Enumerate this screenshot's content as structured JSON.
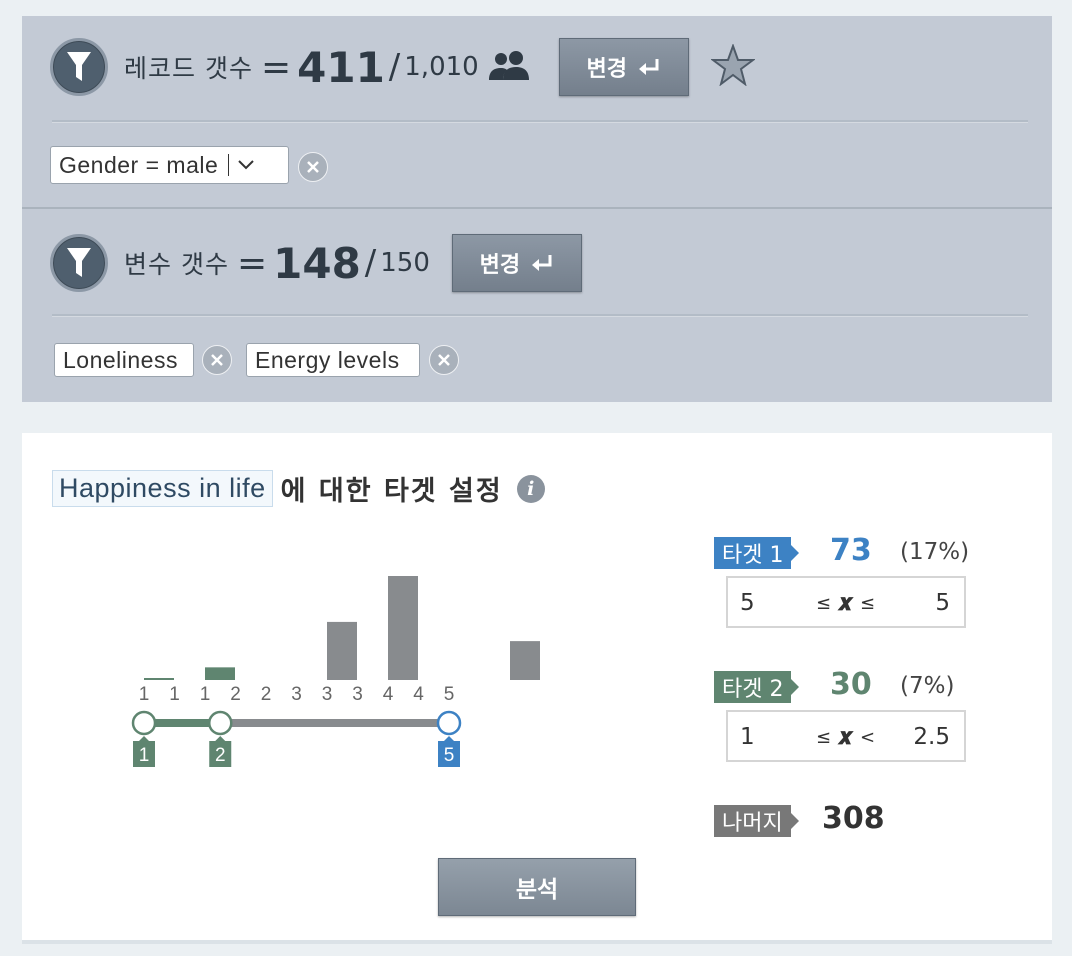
{
  "records": {
    "label": "레코드 갯수",
    "eq": "=",
    "count": "411",
    "slash": "/",
    "total": "1,010",
    "change_label": "변경",
    "filter_chip": "Gender = male"
  },
  "variables": {
    "label": "변수 갯수",
    "eq": "=",
    "count": "148",
    "slash": "/",
    "total": "150",
    "change_label": "변경",
    "chips": [
      "Loneliness",
      "Energy levels"
    ]
  },
  "target": {
    "variable": "Happiness in life",
    "title_suffix": "에 대한 타겟 설정",
    "info_icon": "i",
    "target1": {
      "label": "타겟 1",
      "count": "73",
      "pct": "(17%)",
      "min": "5",
      "op_left": "≤",
      "var": "𝒙",
      "op_right": "≤",
      "max": "5"
    },
    "target2": {
      "label": "타겟 2",
      "count": "30",
      "pct": "(7%)",
      "min": "1",
      "op_left": "≤",
      "var": "𝒙",
      "op_right": "<",
      "max": "2.5"
    },
    "rest": {
      "label": "나머지",
      "count": "308"
    },
    "analyze_label": "분석",
    "colors": {
      "target1": "#3d82c4",
      "target2": "#5f8570",
      "rest": "#787878",
      "bar": "#888b8e"
    }
  },
  "chart_data": {
    "type": "bar",
    "tick_labels": [
      "1",
      "1",
      "1",
      "2",
      "2",
      "3",
      "3",
      "3",
      "4",
      "4",
      "5"
    ],
    "bins": [
      {
        "range": [
          1,
          1.5
        ],
        "count": 3,
        "group": "target2"
      },
      {
        "range": [
          1.5,
          2
        ],
        "count": 27,
        "group": "target2"
      },
      {
        "range": [
          2,
          2.5
        ],
        "count": 0,
        "group": "target2"
      },
      {
        "range": [
          2.5,
          3
        ],
        "count": 124,
        "group": "rest"
      },
      {
        "range": [
          3,
          3.5
        ],
        "count": 222,
        "group": "rest"
      },
      {
        "range": [
          3.5,
          4
        ],
        "count": 0,
        "group": "rest"
      },
      {
        "range": [
          4,
          4.5
        ],
        "count": 83,
        "group": "rest"
      }
    ],
    "slider": {
      "handles": [
        "1",
        "2",
        "5"
      ],
      "min": 1,
      "max": 5
    }
  }
}
